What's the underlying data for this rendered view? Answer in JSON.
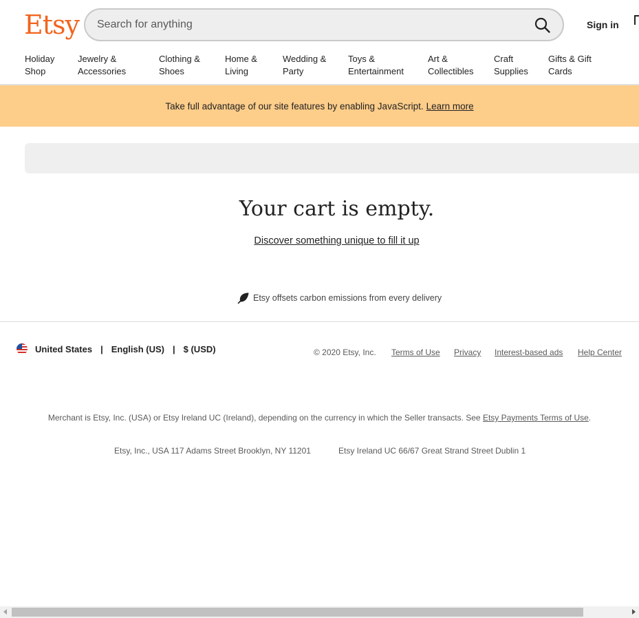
{
  "brand": {
    "logo_text": "Etsy",
    "accent_color": "#f1641e"
  },
  "search": {
    "placeholder": "Search for anything",
    "icon": "search-icon"
  },
  "header": {
    "sign_in_label": "Sign in"
  },
  "categories": [
    {
      "line1": "Holiday",
      "line2": "Shop"
    },
    {
      "line1": "Jewelry &",
      "line2": "Accessories"
    },
    {
      "line1": "Clothing &",
      "line2": "Shoes"
    },
    {
      "line1": "Home &",
      "line2": "Living"
    },
    {
      "line1": "Wedding &",
      "line2": "Party"
    },
    {
      "line1": "Toys &",
      "line2": "Entertainment"
    },
    {
      "line1": "Art &",
      "line2": "Collectibles"
    },
    {
      "line1": "Craft",
      "line2": "Supplies"
    },
    {
      "line1": "Gifts & Gift",
      "line2": "Cards"
    }
  ],
  "banner": {
    "message": "Take full advantage of our site features by enabling JavaScript.",
    "link_label": "Learn more",
    "background_color": "#fdcd8a"
  },
  "cart": {
    "title": "Your cart is empty.",
    "discover_link": "Discover something unique to fill it up",
    "carbon_note": "Etsy offsets carbon emissions from every delivery",
    "carbon_icon": "leaf-icon"
  },
  "footer": {
    "region": "United States",
    "language": "English (US)",
    "currency": "$ (USD)",
    "separator": "|",
    "flag_icon": "us-flag-icon",
    "copyright": "© 2020 Etsy, Inc.",
    "links": [
      "Terms of Use",
      "Privacy",
      "Interest-based ads",
      "Help Center"
    ],
    "merchant_text": "Merchant is Etsy, Inc. (USA) or Etsy Ireland UC (Ireland), depending on the currency in which the Seller transacts. See",
    "merchant_link": "Etsy Payments Terms of Use",
    "merchant_end": ".",
    "address_us": "Etsy, Inc., USA 117 Adams Street Brooklyn, NY 11201",
    "address_ie": "Etsy Ireland UC 66/67 Great Strand Street Dublin 1"
  }
}
